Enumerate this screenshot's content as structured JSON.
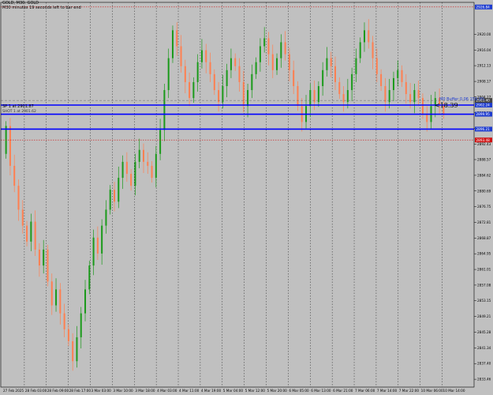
{
  "window": {
    "title": "GOLD, M30: GOLD",
    "info": "M30 minutes 19 seconds left to bar end",
    "cursor_label": "SP 1 at 2901.87",
    "cursor_sub": "SHOT 1 at 2901.62"
  },
  "annotations": {
    "big_label": "<18.39",
    "sub_label": "M0 Buffer 0.06 159.9%"
  },
  "colors": {
    "background": "#c0c0c0",
    "bull": "#1a9a1a",
    "bear": "#ff7f50",
    "level_line": "#0000ff",
    "red_dotted": "#d01010",
    "grid": "#000000"
  },
  "price_axis": {
    "labels": [
      "2920.00",
      "2916.04",
      "2912.13",
      "2908.17",
      "2904.27",
      "2900.30",
      "2896.39",
      "2892.43",
      "2888.57",
      "2884.62",
      "2880.69",
      "2876.75",
      "2872.81",
      "2868.87",
      "2864.95",
      "2861.01",
      "2857.08",
      "2853.15",
      "2849.21",
      "2845.28",
      "2841.34",
      "2837.40",
      "2833.46"
    ],
    "tags": [
      {
        "text": "2926.84",
        "color": "#1e3cd0",
        "level": 2926.84
      },
      {
        "text": "2902.24",
        "color": "#1e3cd0",
        "level": 2902.24
      },
      {
        "text": "2903.40",
        "color": "#444444",
        "level": 2903.4
      },
      {
        "text": "2899.95",
        "color": "#1e3cd0",
        "level": 2899.95
      },
      {
        "text": "2896.21",
        "color": "#1e3cd0",
        "level": 2896.21
      },
      {
        "text": "2893.48",
        "color": "#d01010",
        "level": 2893.48
      }
    ]
  },
  "time_axis": {
    "labels": [
      "27 Feb 2025",
      "28 Feb 03:00",
      "28 Feb 09:00",
      "28 Feb 17:00",
      "3 Mar 03:00",
      "3 Mar 10:00",
      "3 Mar 18:00",
      "4 Mar 03:00",
      "4 Mar 11:00",
      "4 Mar 19:00",
      "5 Mar 04:00",
      "5 Mar 12:00",
      "5 Mar 20:00",
      "6 Mar 05:00",
      "6 Mar 13:00",
      "6 Mar 21:00",
      "7 Mar 06:00",
      "7 Mar 14:00",
      "7 Mar 22:00",
      "10 Mar 06:00",
      "10 Mar 14:00"
    ]
  },
  "chart_data": {
    "type": "candlestick",
    "symbol": "GOLD",
    "timeframe": "M30",
    "y_range": [
      2831.5,
      2928.0
    ],
    "levels": {
      "blue_solid": [
        2902.24,
        2899.95,
        2896.21
      ],
      "red_dotted": [
        2926.84,
        2893.48
      ],
      "gray_dashed": [
        2903.4
      ]
    },
    "candles": [
      [
        2890,
        2897
      ],
      [
        2897,
        2887
      ],
      [
        2887,
        2882
      ],
      [
        2882,
        2876
      ],
      [
        2876,
        2872
      ],
      [
        2872,
        2868
      ],
      [
        2868,
        2873
      ],
      [
        2873,
        2866
      ],
      [
        2866,
        2862
      ],
      [
        2862,
        2866
      ],
      [
        2866,
        2858
      ],
      [
        2858,
        2852
      ],
      [
        2852,
        2856
      ],
      [
        2856,
        2850
      ],
      [
        2850,
        2846
      ],
      [
        2846,
        2843
      ],
      [
        2843,
        2838
      ],
      [
        2838,
        2844
      ],
      [
        2844,
        2850
      ],
      [
        2850,
        2856
      ],
      [
        2856,
        2862
      ],
      [
        2862,
        2869
      ],
      [
        2869,
        2865
      ],
      [
        2865,
        2872
      ],
      [
        2872,
        2876
      ],
      [
        2876,
        2881
      ],
      [
        2881,
        2878
      ],
      [
        2878,
        2884
      ],
      [
        2884,
        2888
      ],
      [
        2888,
        2885
      ],
      [
        2885,
        2882
      ],
      [
        2882,
        2888
      ],
      [
        2888,
        2891
      ],
      [
        2891,
        2888
      ],
      [
        2888,
        2887
      ],
      [
        2887,
        2884
      ],
      [
        2884,
        2890
      ],
      [
        2890,
        2896
      ],
      [
        2896,
        2906
      ],
      [
        2906,
        2914
      ],
      [
        2914,
        2921
      ],
      [
        2921,
        2917
      ],
      [
        2917,
        2912
      ],
      [
        2912,
        2908
      ],
      [
        2908,
        2904
      ],
      [
        2904,
        2908
      ],
      [
        2908,
        2913
      ],
      [
        2913,
        2916
      ],
      [
        2916,
        2913
      ],
      [
        2913,
        2910
      ],
      [
        2910,
        2906
      ],
      [
        2906,
        2903
      ],
      [
        2903,
        2907
      ],
      [
        2907,
        2911
      ],
      [
        2911,
        2914
      ],
      [
        2914,
        2912
      ],
      [
        2912,
        2908
      ],
      [
        2908,
        2902
      ],
      [
        2902,
        2906
      ],
      [
        2906,
        2910
      ],
      [
        2910,
        2913
      ],
      [
        2913,
        2917
      ],
      [
        2917,
        2919
      ],
      [
        2919,
        2915
      ],
      [
        2915,
        2911
      ],
      [
        2911,
        2914
      ],
      [
        2914,
        2918
      ],
      [
        2918,
        2915
      ],
      [
        2915,
        2911
      ],
      [
        2911,
        2907
      ],
      [
        2907,
        2902
      ],
      [
        2902,
        2898
      ],
      [
        2898,
        2902
      ],
      [
        2902,
        2906
      ],
      [
        2906,
        2903
      ],
      [
        2903,
        2907
      ],
      [
        2907,
        2911
      ],
      [
        2911,
        2914
      ],
      [
        2914,
        2912
      ],
      [
        2912,
        2908
      ],
      [
        2908,
        2905
      ],
      [
        2905,
        2903
      ],
      [
        2903,
        2906
      ],
      [
        2906,
        2910
      ],
      [
        2910,
        2914
      ],
      [
        2914,
        2918
      ],
      [
        2918,
        2921
      ],
      [
        2921,
        2918
      ],
      [
        2918,
        2914
      ],
      [
        2914,
        2910
      ],
      [
        2910,
        2907
      ],
      [
        2907,
        2903
      ],
      [
        2903,
        2906
      ],
      [
        2906,
        2909
      ],
      [
        2909,
        2911
      ],
      [
        2911,
        2908
      ],
      [
        2908,
        2905
      ],
      [
        2905,
        2903
      ],
      [
        2903,
        2906
      ],
      [
        2906,
        2904
      ],
      [
        2904,
        2900
      ],
      [
        2900,
        2898
      ],
      [
        2898,
        2902
      ],
      [
        2902,
        2904
      ],
      [
        2904,
        2902
      ],
      [
        2902,
        2900
      ]
    ]
  }
}
